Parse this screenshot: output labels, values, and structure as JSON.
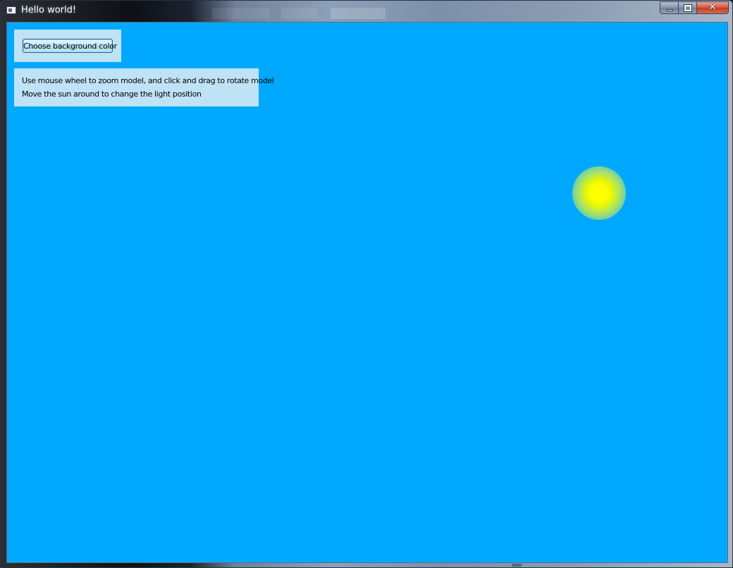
{
  "window": {
    "title": "Hello world!",
    "icon": "app-window-icon",
    "controls": {
      "minimize_icon": "minimize-icon",
      "maximize_icon": "maximize-icon",
      "close_icon": "close-icon",
      "close_glyph": "✕"
    }
  },
  "scene": {
    "background_color": "#00a9ff",
    "sun_color": "#ffff00",
    "sun_icon": "sun-icon"
  },
  "controls": {
    "choose_background_label": "Choose background color"
  },
  "instructions": {
    "line1": "Use mouse wheel to zoom model, and click and drag to rotate model",
    "line2": "Move the sun around to change the light position"
  }
}
